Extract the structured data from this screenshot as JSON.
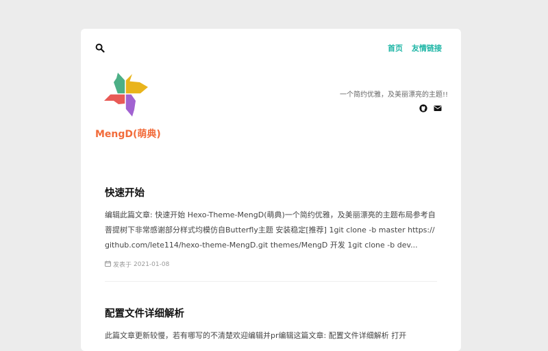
{
  "header": {
    "search_icon": "search-icon",
    "nav": [
      {
        "label": "首页"
      },
      {
        "label": "友情链接"
      }
    ],
    "site_name": "MengD(萌典)",
    "subtitle": "一个简约优雅，及美丽漂亮的主题!!",
    "social": [
      "github-icon",
      "envelope-icon"
    ]
  },
  "colors": {
    "accent": "#1fb6a6",
    "brand": "#f26b3a",
    "background": "#ececec"
  },
  "posts": [
    {
      "title": "快速开始",
      "excerpt": "编辑此篇文章: 快速开始 Hexo-Theme-MengD(萌典)一个简约优雅，及美丽漂亮的主题布局参考自 菩提树下非常感谢部分样式均模仿自Butterfly主题 安装稳定[推荐] 1git clone -b master https://github.com/lete114/hexo-theme-MengD.git themes/MengD 开发 1git clone -b dev...",
      "meta_prefix": "发表于",
      "date": "2021-01-08"
    },
    {
      "title": "配置文件详细解析",
      "excerpt": "此篇文章更新较慢，若有哪写的不清楚欢迎编辑并pr编辑这篇文章: 配置文件详细解析 打开"
    }
  ]
}
